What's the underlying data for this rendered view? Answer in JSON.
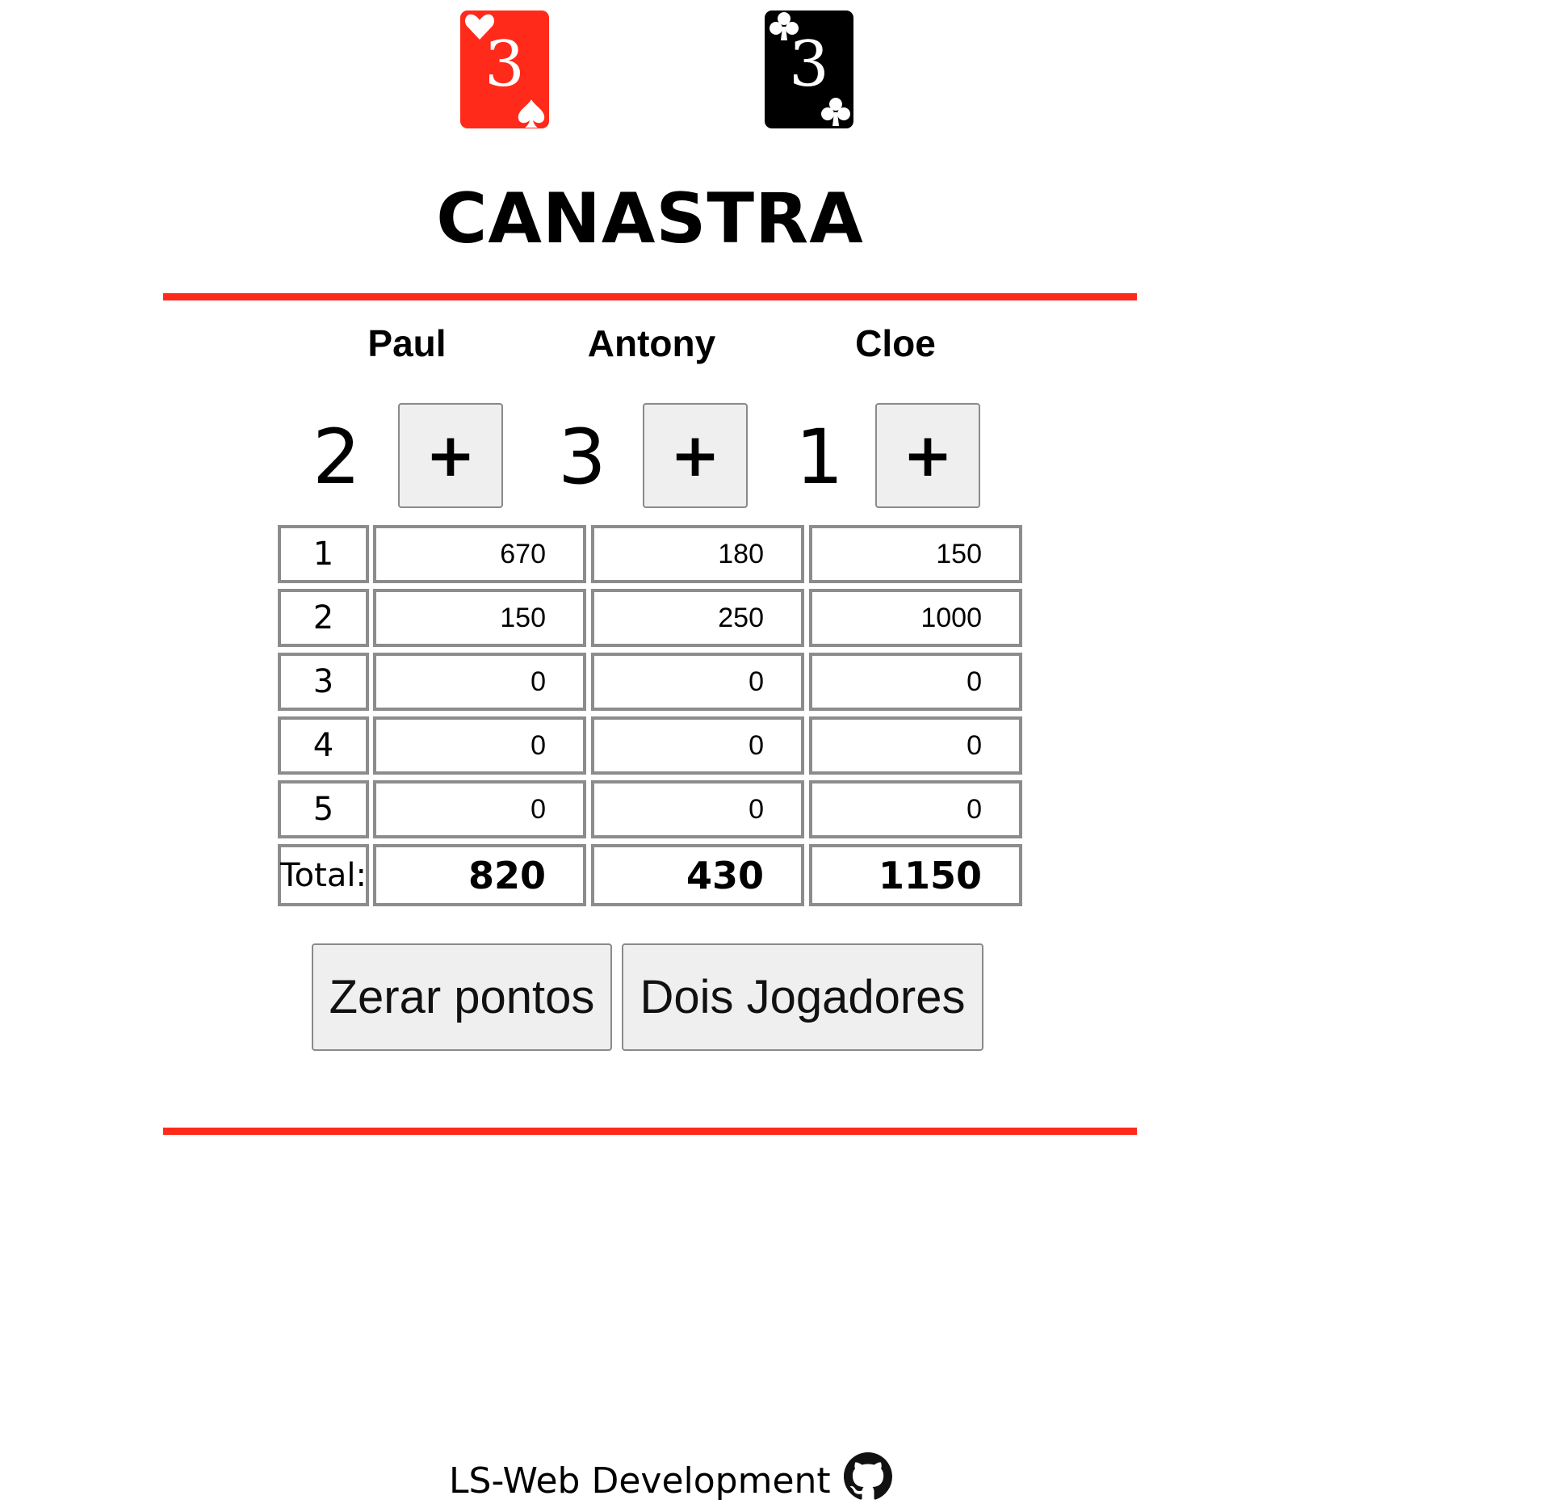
{
  "cards": [
    {
      "rank": "3",
      "suits": [
        "heart",
        "spade"
      ],
      "color": "#ff2a1a"
    },
    {
      "rank": "3",
      "suits": [
        "club",
        "club"
      ],
      "color": "#000000"
    }
  ],
  "title": "CANASTRA",
  "accent_color": "#ff2a1a",
  "players": [
    {
      "name": "Paul",
      "wins": "2",
      "plus_label": "+",
      "total": "820"
    },
    {
      "name": "Antony",
      "wins": "3",
      "plus_label": "+",
      "total": "430"
    },
    {
      "name": "Cloe",
      "wins": "1",
      "plus_label": "+",
      "total": "1150"
    }
  ],
  "rounds": [
    {
      "label": "1",
      "scores": [
        "670",
        "180",
        "150"
      ]
    },
    {
      "label": "2",
      "scores": [
        "150",
        "250",
        "1000"
      ]
    },
    {
      "label": "3",
      "scores": [
        "0",
        "0",
        "0"
      ]
    },
    {
      "label": "4",
      "scores": [
        "0",
        "0",
        "0"
      ]
    },
    {
      "label": "5",
      "scores": [
        "0",
        "0",
        "0"
      ]
    }
  ],
  "total_label": "Total:",
  "buttons": {
    "reset": "Zerar pontos",
    "two_players": "Dois Jogadores"
  },
  "footer": {
    "text": "LS-Web Development",
    "icon": "github-icon"
  }
}
